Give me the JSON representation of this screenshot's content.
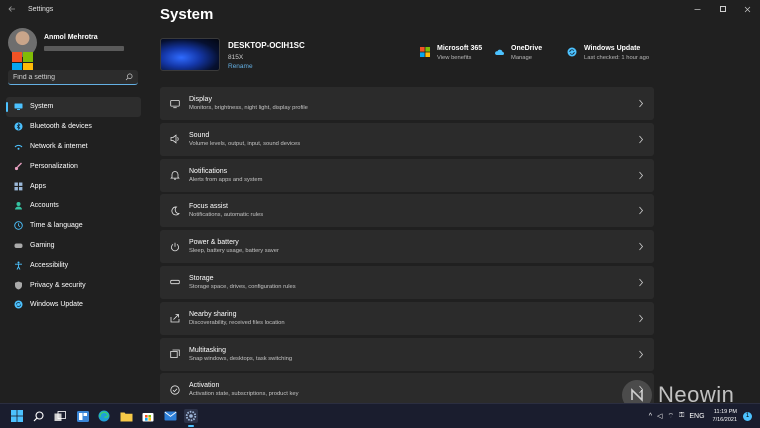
{
  "window": {
    "app_title": "Settings",
    "back_icon": "back-arrow-icon",
    "controls": [
      "minimize-icon",
      "maximize-icon",
      "close-icon"
    ]
  },
  "profile": {
    "name": "Anmol Mehrotra"
  },
  "search": {
    "placeholder": "Find a setting"
  },
  "sidebar": {
    "items": [
      {
        "label": "System",
        "icon": "monitor-icon",
        "color": "#4cc2ff",
        "active": true
      },
      {
        "label": "Bluetooth & devices",
        "icon": "bluetooth-icon",
        "color": "#4cc2ff"
      },
      {
        "label": "Network & internet",
        "icon": "network-icon",
        "color": "#4cc2ff"
      },
      {
        "label": "Personalization",
        "icon": "brush-icon",
        "color": "#e8a0c0"
      },
      {
        "label": "Apps",
        "icon": "apps-icon",
        "color": "#9bb8d8"
      },
      {
        "label": "Accounts",
        "icon": "person-icon",
        "color": "#35c3a2"
      },
      {
        "label": "Time & language",
        "icon": "globe-clock-icon",
        "color": "#4cc2ff"
      },
      {
        "label": "Gaming",
        "icon": "gamepad-icon",
        "color": "#aaaaaa"
      },
      {
        "label": "Accessibility",
        "icon": "accessibility-icon",
        "color": "#4cc2ff"
      },
      {
        "label": "Privacy & security",
        "icon": "shield-icon",
        "color": "#aaaaaa"
      },
      {
        "label": "Windows Update",
        "icon": "update-icon",
        "color": "#4cc2ff"
      }
    ]
  },
  "main": {
    "page_title": "System",
    "device": {
      "name": "DESKTOP-OCIH1SC",
      "model": "815X",
      "rename_label": "Rename"
    },
    "header_tiles": [
      {
        "title": "Microsoft 365",
        "subtitle": "View benefits",
        "icon": "microsoft-logo-icon"
      },
      {
        "title": "OneDrive",
        "subtitle": "Manage",
        "icon": "cloud-icon"
      },
      {
        "title": "Windows Update",
        "subtitle": "Last checked: 1 hour ago",
        "icon": "update-icon"
      }
    ],
    "cards": [
      {
        "title": "Display",
        "desc": "Monitors, brightness, night light, display profile",
        "icon": "display-icon"
      },
      {
        "title": "Sound",
        "desc": "Volume levels, output, input, sound devices",
        "icon": "speaker-icon"
      },
      {
        "title": "Notifications",
        "desc": "Alerts from apps and system",
        "icon": "bell-icon"
      },
      {
        "title": "Focus assist",
        "desc": "Notifications, automatic rules",
        "icon": "moon-icon"
      },
      {
        "title": "Power & battery",
        "desc": "Sleep, battery usage, battery saver",
        "icon": "power-icon"
      },
      {
        "title": "Storage",
        "desc": "Storage space, drives, configuration rules",
        "icon": "storage-icon"
      },
      {
        "title": "Nearby sharing",
        "desc": "Discoverability, received files location",
        "icon": "share-icon"
      },
      {
        "title": "Multitasking",
        "desc": "Snap windows, desktops, task switching",
        "icon": "multitasking-icon"
      },
      {
        "title": "Activation",
        "desc": "Activation state, subscriptions, product key",
        "icon": "check-circle-icon"
      }
    ]
  },
  "watermark": {
    "text": "Neowin"
  },
  "taskbar": {
    "icons": [
      "start-icon",
      "search-icon",
      "task-view-icon",
      "widgets-icon",
      "edge-icon",
      "file-explorer-icon",
      "store-icon",
      "mail-icon",
      "settings-icon"
    ],
    "tray_glyphs": [
      "^",
      "◁",
      "⌔",
      "⚿",
      "ENG"
    ],
    "time": "11:19 PM",
    "date": "7/16/2021",
    "notification_count": "1"
  },
  "colors": {
    "accent": "#4cc2ff",
    "link": "#64b0e4",
    "window_bg": "#202020",
    "card_bg": "#2b2b2b"
  }
}
